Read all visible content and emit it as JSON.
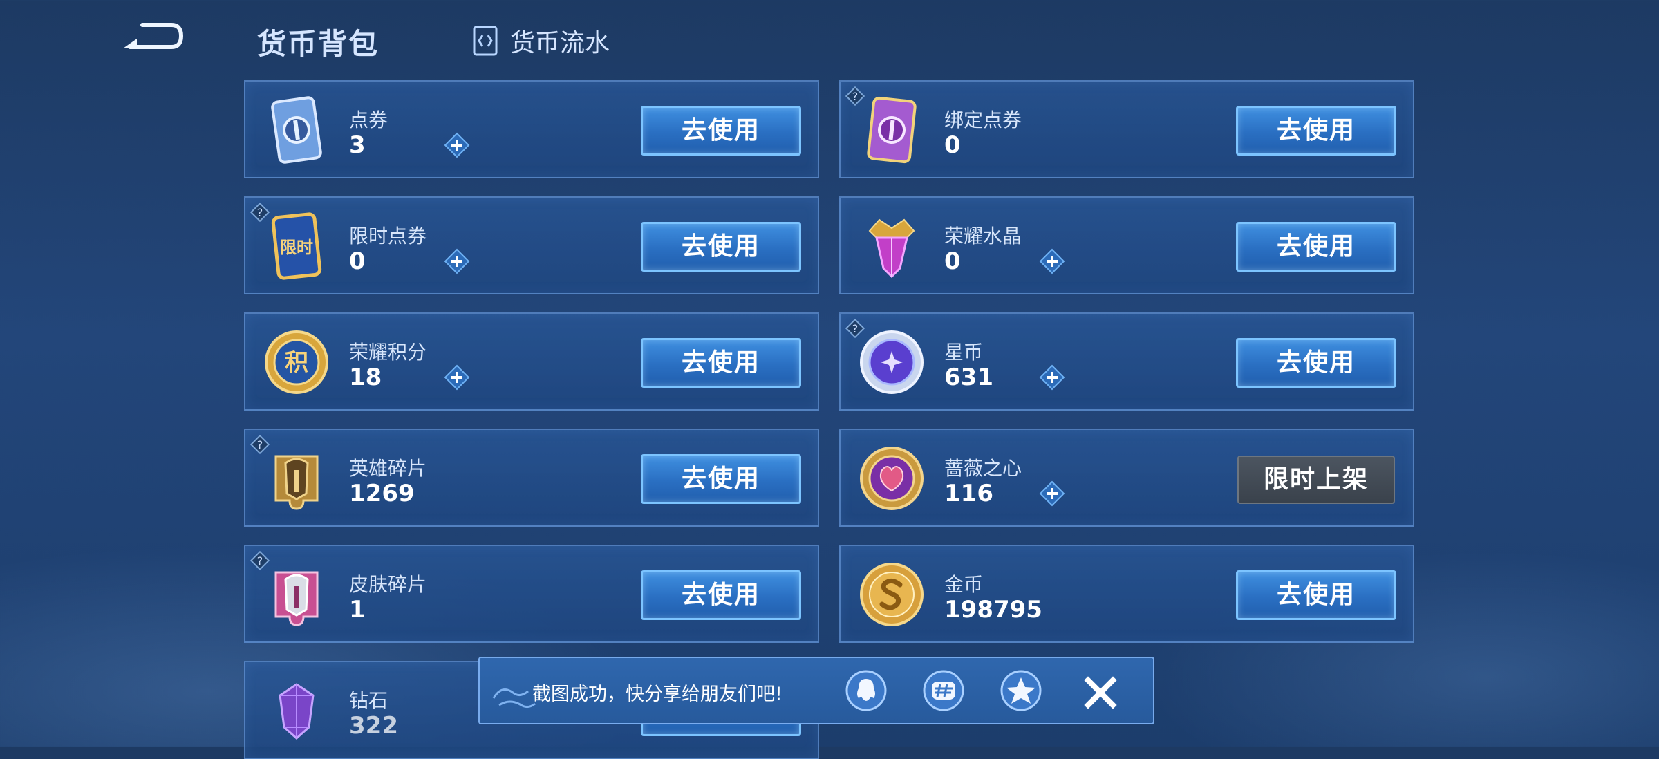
{
  "header": {
    "title": "货币背包",
    "flow_tab_label": "货币流水"
  },
  "use_label": "去使用",
  "limited_label": "限时上架",
  "currencies": [
    {
      "name": "点券",
      "value": "3"
    },
    {
      "name": "绑定点券",
      "value": "0"
    },
    {
      "name": "限时点券",
      "value": "0"
    },
    {
      "name": "荣耀水晶",
      "value": "0"
    },
    {
      "name": "荣耀积分",
      "value": "18"
    },
    {
      "name": "星币",
      "value": "631"
    },
    {
      "name": "英雄碎片",
      "value": "1269"
    },
    {
      "name": "蔷薇之心",
      "value": "116"
    },
    {
      "name": "皮肤碎片",
      "value": "1"
    },
    {
      "name": "金币",
      "value": "198795"
    },
    {
      "name": "钻石",
      "value": "322"
    }
  ],
  "icon_glyphs": {
    "limited_voucher": "限时",
    "points": "积"
  },
  "share": {
    "message": "截图成功，快分享给朋友们吧!"
  },
  "colors": {
    "button_blue": "#2a6fc2",
    "button_border": "#7cc4ff",
    "limited_gray": "#454e58",
    "gold": "#e2b24a"
  }
}
